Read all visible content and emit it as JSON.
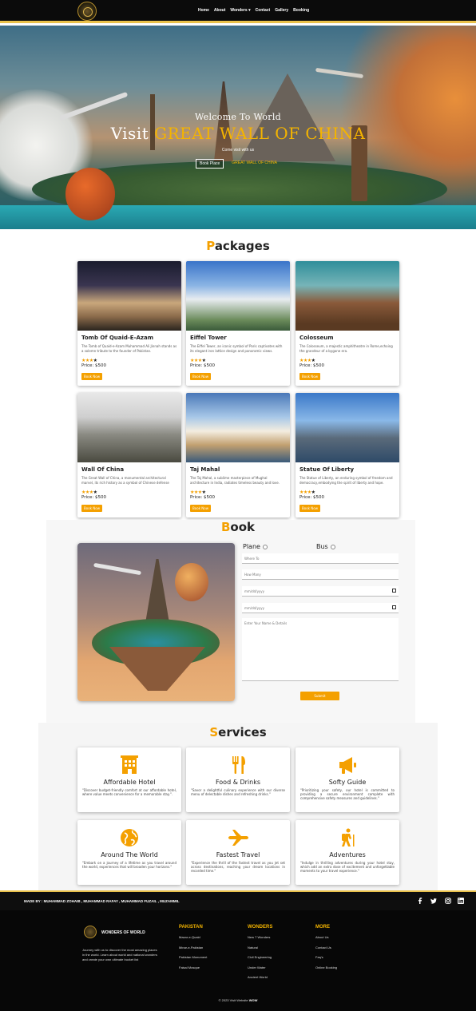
{
  "nav": {
    "items": [
      "Home",
      "About",
      "Wonders",
      "Contact",
      "Gallery",
      "Booking"
    ],
    "wonders_caret": "▾"
  },
  "hero": {
    "welcome": "Welcome To World",
    "visit_prefix": "Visit",
    "highlight": "GREAT WALL OF CHINA",
    "come": "Come visit with us",
    "book_btn": "Book Place",
    "secondary_btn": "GREAT WALL OF CHINA"
  },
  "packages": {
    "heading_first": "P",
    "heading_rest": "ackages",
    "cards": [
      {
        "title": "Tomb Of Quaid-E-Azam",
        "desc": "The Tomb of Quaid-e-Azam Muhammad Ali Jinnah stands as a solemn tribute to the founder of Pakistan.",
        "price": "Price: $500",
        "button": "Book Now",
        "rating": 3
      },
      {
        "title": "Eiffel Tower",
        "desc": "The Eiffel Tower, an iconic symbol of Paris captivates with its elegant iron lattice design and panoramic views.",
        "price": "Price: $500",
        "button": "Book Now",
        "rating": 3
      },
      {
        "title": "Colosseum",
        "desc": "The Colosseum, a majestic amphitheatre in Rome,echoing the grandeur of a bygone era.",
        "price": "Price: $500",
        "button": "Book Now",
        "rating": 3
      },
      {
        "title": "Wall Of China",
        "desc": "The Great Wall of China, a monumental architectural marvel, its rich history as a symbol of Chinese defense",
        "price": "Price: $500",
        "button": "Book Now",
        "rating": 3
      },
      {
        "title": "Taj Mahal",
        "desc": "The Taj Mahal, a sublime masterpiece of Mughal architecture in India, radiates timeless beauty and love.",
        "price": "Price: $500",
        "button": "Book Now",
        "rating": 3
      },
      {
        "title": "Statue Of Liberty",
        "desc": "The Statue of Liberty, an enduring symbol of freedom and democracy,embodying the spirit of liberty and hope.",
        "price": "Price: $500",
        "button": "Book Now",
        "rating": 3
      }
    ]
  },
  "book": {
    "heading_first": "B",
    "heading_rest": "ook",
    "plane_label": "Plane",
    "bus_label": "Bus",
    "where_placeholder": "Where To",
    "how_many_placeholder": "How Many",
    "date1": "mm/dd/yyyy",
    "date2": "mm/dd/yyyy",
    "details_placeholder": "Enter Your Name & Details",
    "submit": "Submit"
  },
  "services": {
    "heading_first": "S",
    "heading_rest": "ervices",
    "items": [
      {
        "title": "Affordable Hotel",
        "desc": "\"Discover budget-friendly comfort at our affordable hotel, where value meets convenience for a memorable stay.\".",
        "icon": "hotel-icon"
      },
      {
        "title": "Food & Drinks",
        "desc": "\"Savor a delightful culinary experience with our diverse menu of delectable dishes and refreshing drinks.\"",
        "icon": "utensils-icon"
      },
      {
        "title": "Softy Guide",
        "desc": "\"Prioritizing your safety, our hotel is committed to providing a secure environment complete with comprehensive safety measures and guidelines.\"",
        "icon": "megaphone-icon"
      },
      {
        "title": "Around The World",
        "desc": "\"Embark on a journey of a lifetime as you travel around the world, experiences that will broaden your horizons.\"",
        "icon": "globe-icon"
      },
      {
        "title": "Fastest Travel",
        "desc": "\"Experience the thrill of the fastest travel as you jet set across destinations, reaching your dream locations in recorded time.\"",
        "icon": "plane-icon"
      },
      {
        "title": "Adventures",
        "desc": "\"Indulge in thrilling adventures during your hotel stay, which add an extra dose of excitement and unforgettable moments to your travel experience.\"",
        "icon": "hiker-icon"
      }
    ]
  },
  "credits": {
    "made_by": "MADE BY : MUHAMMAD ZOHAIB , MUHAMMAD RAFAY , MUHAMMAD FUZAIL , MUZAMMIL"
  },
  "footer": {
    "brand": "WONDERS OF WORLD",
    "about": "Journey with us to discover the most amazing places in the world. Learn about world and national wonders and create your own ultimate bucket list",
    "columns": [
      {
        "heading": "PAKISTAN",
        "links": [
          "Mazar-e-Quaid",
          "Minar-e-Pakistan",
          "Pakistan Monument",
          "Faisal Mosque"
        ]
      },
      {
        "heading": "WONDERS",
        "links": [
          "New 7 Wonders",
          "Natural",
          "Civil Engineering",
          "Under Water",
          "Ancient World"
        ]
      },
      {
        "heading": "MORE",
        "links": [
          "About Us",
          "Contact Us",
          "Faq's",
          "Online Booking"
        ]
      }
    ],
    "copyright_prefix": "© 2023 Visit Website",
    "copyright_bold": "WOW"
  },
  "colors": {
    "accent": "#f4a000",
    "gold": "#e9c14a",
    "dark": "#0b0b0b"
  }
}
